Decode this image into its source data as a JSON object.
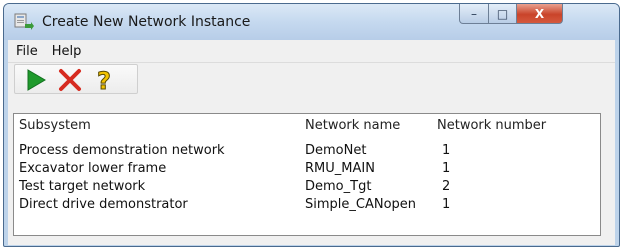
{
  "window": {
    "title": "Create New Network Instance",
    "controls": {
      "minimize": "–",
      "maximize": "□",
      "close": "X"
    }
  },
  "menu": [
    {
      "label": "File"
    },
    {
      "label": "Help"
    }
  ],
  "toolbar": [
    {
      "name": "play-icon",
      "color": "#1f9a2c"
    },
    {
      "name": "red-x-icon",
      "color": "#d62b20"
    },
    {
      "name": "question-mark-icon",
      "color": "#f2c200"
    }
  ],
  "table": {
    "columns": [
      "Subsystem",
      "Network name",
      "Network number"
    ],
    "rows": [
      [
        "Process demonstration network",
        "DemoNet",
        "1"
      ],
      [
        "Excavator lower frame",
        "RMU_MAIN",
        "1"
      ],
      [
        "Test target network",
        "Demo_Tgt",
        "2"
      ],
      [
        "Direct drive demonstrator",
        "Simple_CANopen",
        "1"
      ]
    ]
  }
}
